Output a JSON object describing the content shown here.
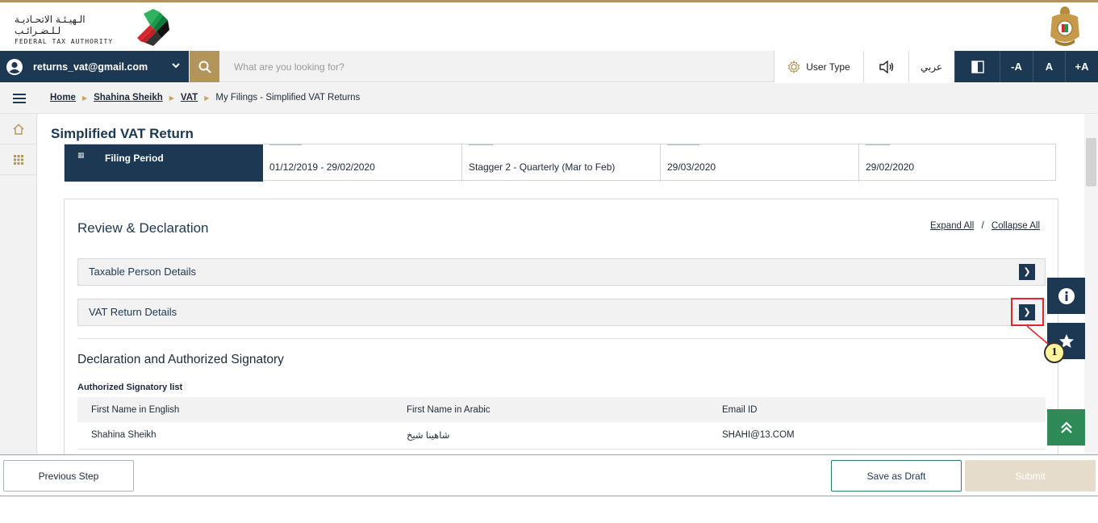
{
  "header": {
    "logo_arabic": "الـهيـئـة الاتحـاديـة لـلـضـرائـب",
    "logo_english": "FEDERAL TAX AUTHORITY"
  },
  "navbar": {
    "user_email": "returns_vat@gmail.com",
    "search_placeholder": "What are you looking for?",
    "user_type": "User Type",
    "language": "عربي",
    "font_decrease": "-A",
    "font_normal": "A",
    "font_increase": "+A"
  },
  "breadcrumb": {
    "items": [
      "Home",
      "Shahina Sheikh",
      "VAT"
    ],
    "current": "My Filings - Simplified VAT Returns"
  },
  "page": {
    "title": "Simplified VAT Return"
  },
  "period": {
    "label": "Filing Period",
    "cells": [
      {
        "value": "01/12/2019 - 29/02/2020"
      },
      {
        "value": "Stagger 2 - Quarterly (Mar to Feb)"
      },
      {
        "value": "29/03/2020"
      },
      {
        "value": "29/02/2020"
      }
    ]
  },
  "review": {
    "title": "Review & Declaration",
    "expand_all": "Expand All",
    "separator": "/",
    "collapse_all": "Collapse All",
    "sections": [
      "Taxable Person Details",
      "VAT Return Details"
    ]
  },
  "declaration": {
    "title": "Declaration and Authorized Signatory",
    "list_label": "Authorized Signatory list",
    "columns": [
      "First Name in English",
      "First Name in Arabic",
      "Email ID"
    ],
    "rows": [
      [
        "Shahina Sheikh",
        "شاهينا شيخ",
        "SHAHI@13.COM"
      ]
    ]
  },
  "annotation": {
    "callout_number": "1"
  },
  "footer": {
    "previous": "Previous Step",
    "save_draft": "Save as Draft",
    "submit": "Submit"
  },
  "colors": {
    "primary": "#1d3852",
    "gold": "#b3945a",
    "green": "#2e8b57",
    "highlight_red": "#e0272c"
  },
  "icons": [
    "user-avatar-icon",
    "chevron-down-icon",
    "search-icon",
    "gear-icon",
    "speaker-icon",
    "contrast-icon",
    "hamburger-icon",
    "home-icon",
    "grid-icon",
    "calendar-icon",
    "info-icon",
    "star-icon",
    "double-chevron-up-icon"
  ]
}
